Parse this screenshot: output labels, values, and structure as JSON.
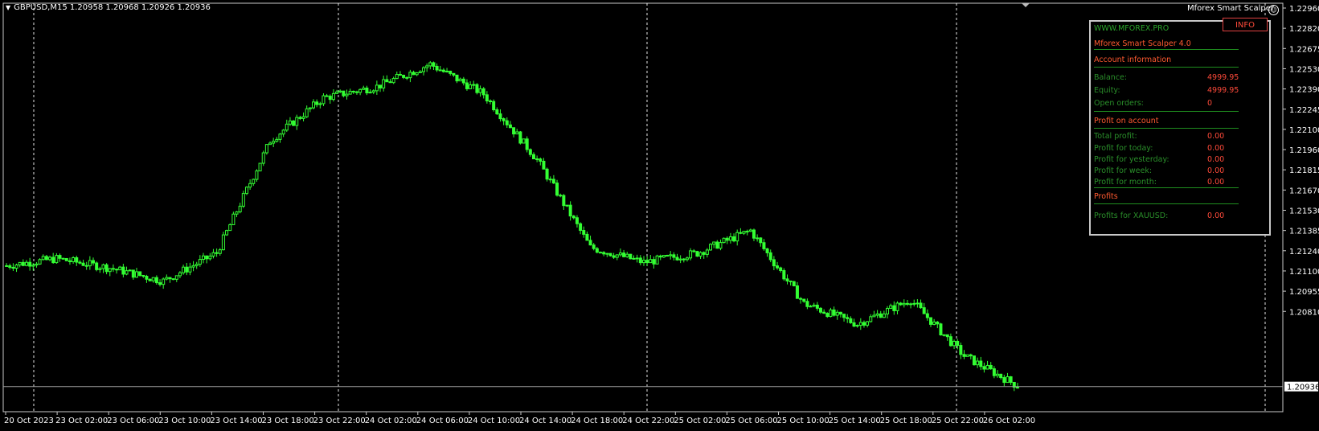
{
  "header": {
    "symbol_info": "GBPUSD,M15  1.20958 1.20968 1.20926 1.20936",
    "ea_name": "Mforex Smart Scalper"
  },
  "price_axis": {
    "labels": [
      "1.22960",
      "1.22820",
      "1.22675",
      "1.22530",
      "1.22390",
      "1.22245",
      "1.22100",
      "1.21960",
      "1.21815",
      "1.21670",
      "1.21530",
      "1.21385",
      "1.21240",
      "1.21100",
      "1.20955",
      "1.20810"
    ],
    "current_price": "1.20936"
  },
  "time_axis": {
    "labels": [
      "20 Oct 2023",
      "23 Oct 02:00",
      "23 Oct 06:00",
      "23 Oct 10:00",
      "23 Oct 14:00",
      "23 Oct 18:00",
      "23 Oct 22:00",
      "24 Oct 02:00",
      "24 Oct 06:00",
      "24 Oct 10:00",
      "24 Oct 14:00",
      "24 Oct 18:00",
      "24 Oct 22:00",
      "25 Oct 02:00",
      "25 Oct 06:00",
      "25 Oct 10:00",
      "25 Oct 14:00",
      "25 Oct 18:00",
      "25 Oct 22:00",
      "26 Oct 02:00"
    ]
  },
  "colors": {
    "background": "#000000",
    "candle": "#33ff33",
    "grid": "#ffffff",
    "panel_accent": "#ff4a3a",
    "panel_text": "#2aa52a"
  },
  "panel": {
    "info_button": "INFO",
    "website": "WWW.MFOREX.PRO",
    "product": "Mforex Smart Scalper 4.0",
    "account_header": "Account information",
    "balance_label": "Balance:",
    "balance_value": "4999.95",
    "equity_label": "Equity:",
    "equity_value": "4999.95",
    "open_orders_label": "Open orders:",
    "open_orders_value": "0",
    "profit_header": "Profit on account",
    "total_profit_label": "Total profit:",
    "total_profit_value": "0.00",
    "today_label": "Profit for today:",
    "today_value": "0.00",
    "yesterday_label": "Profit for yesterday:",
    "yesterday_value": "0.00",
    "week_label": "Profit for week:",
    "week_value": "0.00",
    "month_label": "Profit for month:",
    "month_value": "0.00",
    "profits_header": "Profits",
    "xauusd_label": "Profits for XAUUSD:",
    "xauusd_value": "0.00"
  },
  "chart_data": {
    "type": "candlestick",
    "symbol": "GBPUSD",
    "timeframe": "M15",
    "ylim": [
      1.2081,
      1.2296
    ],
    "close_path": [
      {
        "t": "20 Oct 2023",
        "price": 1.2158
      },
      {
        "t": "23 Oct 02:00",
        "price": 1.2162
      },
      {
        "t": "23 Oct 06:00",
        "price": 1.2157
      },
      {
        "t": "23 Oct 10:00",
        "price": 1.215
      },
      {
        "t": "23 Oct 14:00",
        "price": 1.2165
      },
      {
        "t": "23 Oct 18:00",
        "price": 1.2225
      },
      {
        "t": "23 Oct 22:00",
        "price": 1.2248
      },
      {
        "t": "24 Oct 02:00",
        "price": 1.2254
      },
      {
        "t": "24 Oct 06:00",
        "price": 1.2266
      },
      {
        "t": "24 Oct 10:00",
        "price": 1.225
      },
      {
        "t": "24 Oct 14:00",
        "price": 1.2215
      },
      {
        "t": "24 Oct 18:00",
        "price": 1.2168
      },
      {
        "t": "24 Oct 22:00",
        "price": 1.216
      },
      {
        "t": "25 Oct 02:00",
        "price": 1.2165
      },
      {
        "t": "25 Oct 06:00",
        "price": 1.2177
      },
      {
        "t": "25 Oct 10:00",
        "price": 1.2138
      },
      {
        "t": "25 Oct 14:00",
        "price": 1.2127
      },
      {
        "t": "25 Oct 18:00",
        "price": 1.214
      },
      {
        "t": "25 Oct 22:00",
        "price": 1.211
      },
      {
        "t": "26 Oct 02:00",
        "price": 1.2094
      }
    ]
  }
}
